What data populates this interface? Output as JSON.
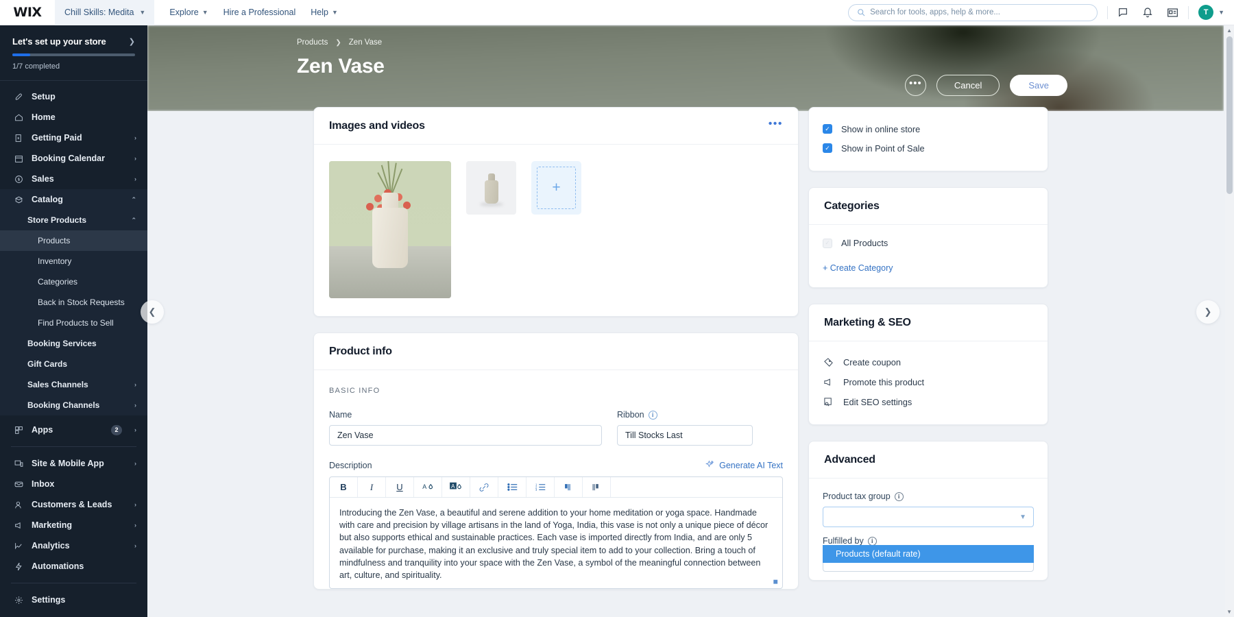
{
  "topbar": {
    "logo": "WIX",
    "site_name": "Chill Skills: Medita",
    "nav": [
      {
        "label": "Explore",
        "caret": true
      },
      {
        "label": "Hire a Professional",
        "caret": false
      },
      {
        "label": "Help",
        "caret": true
      }
    ],
    "search_placeholder": "Search for tools, apps, help & more...",
    "avatar_initial": "T"
  },
  "sidebar": {
    "setup": {
      "title": "Let's set up your store",
      "progress_label": "1/7 completed",
      "progress_percent": 14
    },
    "items": [
      {
        "label": "Setup",
        "icon": "rocket-icon",
        "chevron": ""
      },
      {
        "label": "Home",
        "icon": "home-icon",
        "chevron": ""
      },
      {
        "label": "Getting Paid",
        "icon": "payments-icon",
        "chevron": "›"
      },
      {
        "label": "Booking Calendar",
        "icon": "calendar-icon",
        "chevron": "›"
      },
      {
        "label": "Sales",
        "icon": "dollar-icon",
        "chevron": "›"
      },
      {
        "label": "Catalog",
        "icon": "catalog-icon",
        "chevron": "⌃"
      }
    ],
    "catalog_children": [
      {
        "label": "Store Products",
        "chevron": "⌃",
        "level": 1
      },
      {
        "label": "Products",
        "chevron": "",
        "level": 2,
        "active": true
      },
      {
        "label": "Inventory",
        "chevron": "",
        "level": 2
      },
      {
        "label": "Categories",
        "chevron": "",
        "level": 2
      },
      {
        "label": "Back in Stock Requests",
        "chevron": "",
        "level": 2
      },
      {
        "label": "Find Products to Sell",
        "chevron": "",
        "level": 2
      },
      {
        "label": "Booking Services",
        "chevron": "",
        "level": 1
      },
      {
        "label": "Gift Cards",
        "chevron": "",
        "level": 1
      },
      {
        "label": "Sales Channels",
        "chevron": "›",
        "level": 1
      },
      {
        "label": "Booking Channels",
        "chevron": "›",
        "level": 1
      }
    ],
    "apps": {
      "label": "Apps",
      "icon": "apps-icon",
      "badge": "2",
      "chevron": "›"
    },
    "items_lower": [
      {
        "label": "Site & Mobile App",
        "icon": "monitor-icon",
        "chevron": "›"
      },
      {
        "label": "Inbox",
        "icon": "inbox-icon",
        "chevron": ""
      },
      {
        "label": "Customers & Leads",
        "icon": "customers-icon",
        "chevron": "›"
      },
      {
        "label": "Marketing",
        "icon": "megaphone-icon",
        "chevron": "›"
      },
      {
        "label": "Analytics",
        "icon": "chart-icon",
        "chevron": "›"
      },
      {
        "label": "Automations",
        "icon": "automation-icon",
        "chevron": ""
      }
    ],
    "settings": {
      "label": "Settings",
      "icon": "gear-icon"
    }
  },
  "hero": {
    "breadcrumb_parent": "Products",
    "breadcrumb_sep": "❯",
    "breadcrumb_current": "Zen Vase",
    "title": "Zen Vase",
    "more_label": "•••",
    "cancel_label": "Cancel",
    "save_label": "Save"
  },
  "media_card": {
    "title": "Images and videos",
    "more_label": "•••",
    "add_label": "+"
  },
  "product_info": {
    "title": "Product info",
    "section_label": "BASIC INFO",
    "name_label": "Name",
    "name_value": "Zen Vase",
    "ribbon_label": "Ribbon",
    "ribbon_value": "Till Stocks Last",
    "description_label": "Description",
    "generate_ai_label": "Generate AI Text",
    "toolbar": [
      {
        "name": "bold",
        "glyph": "B"
      },
      {
        "name": "italic",
        "glyph": "I"
      },
      {
        "name": "underline",
        "glyph": "U"
      },
      {
        "name": "text-color",
        "glyph": "A"
      },
      {
        "name": "highlight-color",
        "glyph": "A"
      },
      {
        "name": "link",
        "glyph": "🔗"
      },
      {
        "name": "bulleted-list",
        "glyph": "≔"
      },
      {
        "name": "numbered-list",
        "glyph": "≔"
      },
      {
        "name": "align-ltr",
        "glyph": "¶"
      },
      {
        "name": "align-rtl",
        "glyph": "¶"
      }
    ],
    "description_text": "Introducing the Zen Vase, a beautiful and serene addition to your home meditation or yoga space. Handmade with care and precision by village artisans in the land of Yoga, India, this vase is not only a unique piece of décor but also supports ethical and sustainable practices. Each vase is imported directly from India, and are only 5 available for purchase, making it an exclusive and truly special item to add to your collection. Bring a touch of mindfulness and tranquility into your space with the Zen Vase, a symbol of the meaningful connection between art, culture, and spirituality."
  },
  "visibility": {
    "options": [
      {
        "label": "Show in online store",
        "checked": true
      },
      {
        "label": "Show in Point of Sale",
        "checked": true
      }
    ]
  },
  "categories": {
    "title": "Categories",
    "items": [
      {
        "label": "All Products",
        "checked": false,
        "disabled": true
      }
    ],
    "create_label": "+ Create Category"
  },
  "marketing": {
    "title": "Marketing & SEO",
    "items": [
      {
        "label": "Create coupon",
        "icon": "coupon-icon"
      },
      {
        "label": "Promote this product",
        "icon": "megaphone-icon"
      },
      {
        "label": "Edit SEO settings",
        "icon": "seo-icon"
      }
    ]
  },
  "advanced": {
    "title": "Advanced",
    "tax_group_label": "Product tax group",
    "tax_group_value": "",
    "tax_dropdown_option": "Products (default rate)",
    "fulfilled_by_label": "Fulfilled by"
  },
  "nav_arrows": {
    "prev": "❮",
    "next": "❯"
  },
  "colors": {
    "accent_blue": "#3573c4",
    "checkbox_blue": "#2b87e8",
    "dropdown_blue": "#3e96e8",
    "sidebar_bg": "#16202c",
    "avatar_green": "#0f9d8c"
  }
}
